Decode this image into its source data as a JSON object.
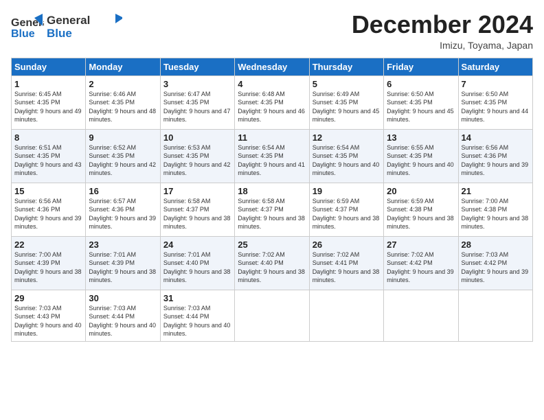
{
  "header": {
    "logo_general": "General",
    "logo_blue": "Blue",
    "month_title": "December 2024",
    "location": "Imizu, Toyama, Japan"
  },
  "weekdays": [
    "Sunday",
    "Monday",
    "Tuesday",
    "Wednesday",
    "Thursday",
    "Friday",
    "Saturday"
  ],
  "weeks": [
    [
      {
        "day": "1",
        "sunrise": "6:45 AM",
        "sunset": "4:35 PM",
        "daylight": "9 hours and 49 minutes."
      },
      {
        "day": "2",
        "sunrise": "6:46 AM",
        "sunset": "4:35 PM",
        "daylight": "9 hours and 48 minutes."
      },
      {
        "day": "3",
        "sunrise": "6:47 AM",
        "sunset": "4:35 PM",
        "daylight": "9 hours and 47 minutes."
      },
      {
        "day": "4",
        "sunrise": "6:48 AM",
        "sunset": "4:35 PM",
        "daylight": "9 hours and 46 minutes."
      },
      {
        "day": "5",
        "sunrise": "6:49 AM",
        "sunset": "4:35 PM",
        "daylight": "9 hours and 45 minutes."
      },
      {
        "day": "6",
        "sunrise": "6:50 AM",
        "sunset": "4:35 PM",
        "daylight": "9 hours and 45 minutes."
      },
      {
        "day": "7",
        "sunrise": "6:50 AM",
        "sunset": "4:35 PM",
        "daylight": "9 hours and 44 minutes."
      }
    ],
    [
      {
        "day": "8",
        "sunrise": "6:51 AM",
        "sunset": "4:35 PM",
        "daylight": "9 hours and 43 minutes."
      },
      {
        "day": "9",
        "sunrise": "6:52 AM",
        "sunset": "4:35 PM",
        "daylight": "9 hours and 42 minutes."
      },
      {
        "day": "10",
        "sunrise": "6:53 AM",
        "sunset": "4:35 PM",
        "daylight": "9 hours and 42 minutes."
      },
      {
        "day": "11",
        "sunrise": "6:54 AM",
        "sunset": "4:35 PM",
        "daylight": "9 hours and 41 minutes."
      },
      {
        "day": "12",
        "sunrise": "6:54 AM",
        "sunset": "4:35 PM",
        "daylight": "9 hours and 40 minutes."
      },
      {
        "day": "13",
        "sunrise": "6:55 AM",
        "sunset": "4:35 PM",
        "daylight": "9 hours and 40 minutes."
      },
      {
        "day": "14",
        "sunrise": "6:56 AM",
        "sunset": "4:36 PM",
        "daylight": "9 hours and 39 minutes."
      }
    ],
    [
      {
        "day": "15",
        "sunrise": "6:56 AM",
        "sunset": "4:36 PM",
        "daylight": "9 hours and 39 minutes."
      },
      {
        "day": "16",
        "sunrise": "6:57 AM",
        "sunset": "4:36 PM",
        "daylight": "9 hours and 39 minutes."
      },
      {
        "day": "17",
        "sunrise": "6:58 AM",
        "sunset": "4:37 PM",
        "daylight": "9 hours and 38 minutes."
      },
      {
        "day": "18",
        "sunrise": "6:58 AM",
        "sunset": "4:37 PM",
        "daylight": "9 hours and 38 minutes."
      },
      {
        "day": "19",
        "sunrise": "6:59 AM",
        "sunset": "4:37 PM",
        "daylight": "9 hours and 38 minutes."
      },
      {
        "day": "20",
        "sunrise": "6:59 AM",
        "sunset": "4:38 PM",
        "daylight": "9 hours and 38 minutes."
      },
      {
        "day": "21",
        "sunrise": "7:00 AM",
        "sunset": "4:38 PM",
        "daylight": "9 hours and 38 minutes."
      }
    ],
    [
      {
        "day": "22",
        "sunrise": "7:00 AM",
        "sunset": "4:39 PM",
        "daylight": "9 hours and 38 minutes."
      },
      {
        "day": "23",
        "sunrise": "7:01 AM",
        "sunset": "4:39 PM",
        "daylight": "9 hours and 38 minutes."
      },
      {
        "day": "24",
        "sunrise": "7:01 AM",
        "sunset": "4:40 PM",
        "daylight": "9 hours and 38 minutes."
      },
      {
        "day": "25",
        "sunrise": "7:02 AM",
        "sunset": "4:40 PM",
        "daylight": "9 hours and 38 minutes."
      },
      {
        "day": "26",
        "sunrise": "7:02 AM",
        "sunset": "4:41 PM",
        "daylight": "9 hours and 38 minutes."
      },
      {
        "day": "27",
        "sunrise": "7:02 AM",
        "sunset": "4:42 PM",
        "daylight": "9 hours and 39 minutes."
      },
      {
        "day": "28",
        "sunrise": "7:03 AM",
        "sunset": "4:42 PM",
        "daylight": "9 hours and 39 minutes."
      }
    ],
    [
      {
        "day": "29",
        "sunrise": "7:03 AM",
        "sunset": "4:43 PM",
        "daylight": "9 hours and 40 minutes."
      },
      {
        "day": "30",
        "sunrise": "7:03 AM",
        "sunset": "4:44 PM",
        "daylight": "9 hours and 40 minutes."
      },
      {
        "day": "31",
        "sunrise": "7:03 AM",
        "sunset": "4:44 PM",
        "daylight": "9 hours and 40 minutes."
      },
      null,
      null,
      null,
      null
    ]
  ]
}
